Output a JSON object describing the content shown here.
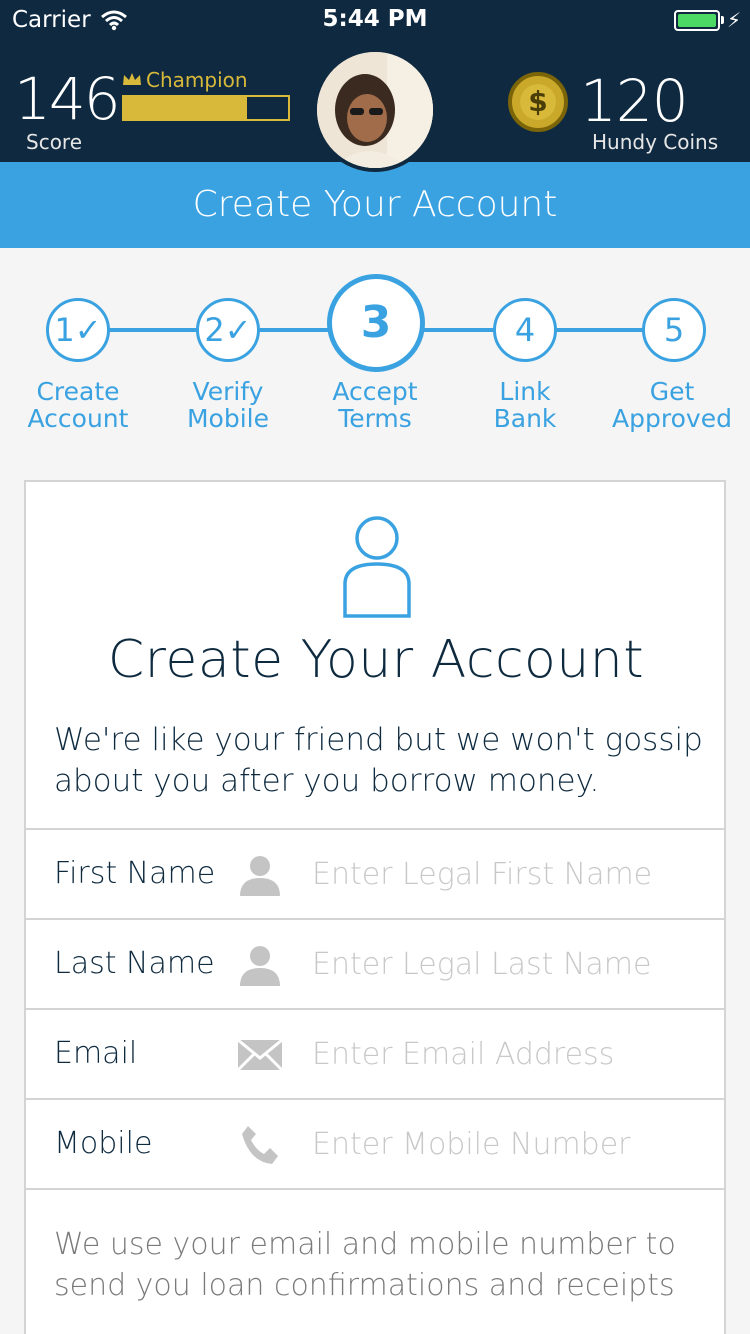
{
  "status_bar": {
    "carrier": "Carrier",
    "time": "5:44 PM"
  },
  "header": {
    "score": "146",
    "score_label": "Score",
    "rank": "Champion",
    "rank_progress": 0.75,
    "coins": "120",
    "coins_label": "Hundy Coins",
    "coin_symbol": "$"
  },
  "title_bar": {
    "title": "Create Your Account"
  },
  "steps": [
    {
      "number": "1✓",
      "label_line1": "Create",
      "label_line2": "Account",
      "state": "done"
    },
    {
      "number": "2✓",
      "label_line1": "Verify",
      "label_line2": "Mobile",
      "state": "done"
    },
    {
      "number": "3",
      "label_line1": "Accept",
      "label_line2": "Terms",
      "state": "active"
    },
    {
      "number": "4",
      "label_line1": "Link",
      "label_line2": "Bank",
      "state": "pending"
    },
    {
      "number": "5",
      "label_line1": "Get",
      "label_line2": "Approved",
      "state": "pending"
    }
  ],
  "card": {
    "title": "Create Your Account",
    "description": "We're like your friend but we won't gossip about you after you borrow money.",
    "fields": [
      {
        "label": "First Name",
        "placeholder": "Enter Legal First Name",
        "icon": "person-icon"
      },
      {
        "label": "Last Name",
        "placeholder": "Enter Legal Last Name",
        "icon": "person-icon"
      },
      {
        "label": "Email",
        "placeholder": "Enter Email Address",
        "icon": "envelope-icon"
      },
      {
        "label": "Mobile",
        "placeholder": "Enter Mobile Number",
        "icon": "phone-icon"
      }
    ],
    "footnote": "We use your email and mobile number to send you loan confirmations and receipts"
  },
  "colors": {
    "header_bg": "#0f2a40",
    "accent_blue": "#3aa2e1",
    "gold": "#d8b93a",
    "battery_green": "#4cd964"
  }
}
